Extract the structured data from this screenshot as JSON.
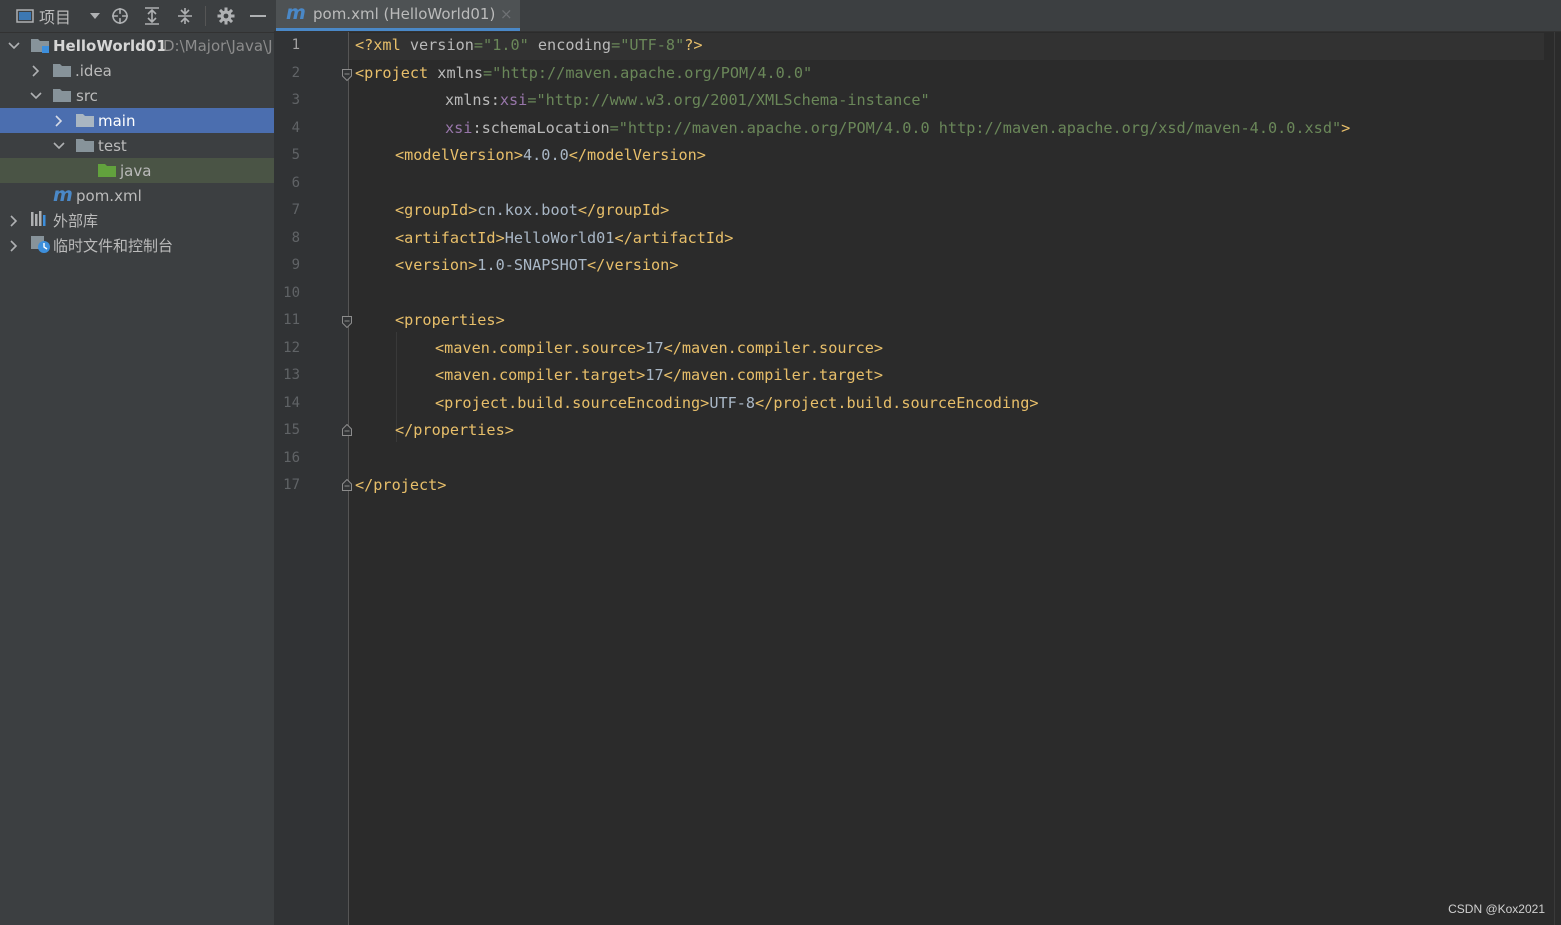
{
  "colors": {
    "sidebar_bg": "#3c3f41",
    "editor_bg": "#2b2b2b",
    "selection": "#4b6eaf",
    "test_highlight": "#4a5445",
    "tag": "#e8bf6a",
    "attribute_value": "#6a8759",
    "namespace": "#9876aa",
    "maven_icon": "#4a88c7"
  },
  "project_panel": {
    "title": "项目",
    "toolbar_icons": [
      "project-view-icon",
      "dropdown-icon",
      "locate-icon",
      "expand-all-icon",
      "collapse-all-icon",
      "gear-icon",
      "minimize-icon"
    ],
    "tree": [
      {
        "label": "HelloWorld01",
        "path": "D:\\Major\\Java\\J",
        "icon": "module-folder-icon",
        "expanded": true
      },
      {
        "label": ".idea",
        "icon": "folder-icon",
        "expanded": false
      },
      {
        "label": "src",
        "icon": "folder-icon",
        "expanded": true
      },
      {
        "label": "main",
        "icon": "folder-icon",
        "expanded": false,
        "selected": true
      },
      {
        "label": "test",
        "icon": "folder-icon",
        "expanded": true
      },
      {
        "label": "java",
        "icon": "test-source-folder-icon"
      },
      {
        "label": "pom.xml",
        "icon": "maven-icon"
      },
      {
        "label": "外部库",
        "icon": "library-icon",
        "expanded": false
      },
      {
        "label": "临时文件和控制台",
        "icon": "scratches-icon",
        "expanded": false
      }
    ]
  },
  "editor": {
    "tab": {
      "label": "pom.xml (HelloWorld01)",
      "icon": "maven-icon",
      "close": "×"
    },
    "current_line": 1,
    "lines": [
      {
        "n": "1"
      },
      {
        "n": "2"
      },
      {
        "n": "3"
      },
      {
        "n": "4"
      },
      {
        "n": "5"
      },
      {
        "n": "6"
      },
      {
        "n": "7"
      },
      {
        "n": "8"
      },
      {
        "n": "9"
      },
      {
        "n": "10"
      },
      {
        "n": "11"
      },
      {
        "n": "12"
      },
      {
        "n": "13"
      },
      {
        "n": "14"
      },
      {
        "n": "15"
      },
      {
        "n": "16"
      },
      {
        "n": "17"
      }
    ],
    "code": {
      "l1": {
        "open": "<?xml ",
        "a1": "version",
        "eq1": "=",
        "v1": "\"1.0\"",
        "a2": " encoding",
        "eq2": "=",
        "v2": "\"UTF-8\"",
        "close": "?>"
      },
      "l2": {
        "open": "<project ",
        "a1": "xmlns",
        "eq": "=",
        "v1": "\"http://maven.apache.org/POM/4.0.0\""
      },
      "l3": {
        "a1": "xmlns",
        "colon": ":",
        "ns": "xsi",
        "eq": "=",
        "v1": "\"http://www.w3.org/2001/XMLSchema-instance\""
      },
      "l4": {
        "ns": "xsi",
        "colon": ":",
        "a1": "schemaLocation",
        "eq": "=",
        "v1": "\"http://maven.apache.org/POM/4.0.0 http://maven.apache.org/xsd/maven-4.0.0.xsd\"",
        "close": ">"
      },
      "l5": {
        "open": "<modelVersion>",
        "text": "4.0.0",
        "close": "</modelVersion>"
      },
      "l7": {
        "open": "<groupId>",
        "text": "cn.kox.boot",
        "close": "</groupId>"
      },
      "l8": {
        "open": "<artifactId>",
        "text": "HelloWorld01",
        "close": "</artifactId>"
      },
      "l9": {
        "open": "<version>",
        "text": "1.0-SNAPSHOT",
        "close": "</version>"
      },
      "l11": {
        "open": "<properties>"
      },
      "l12": {
        "open": "<maven.compiler.source>",
        "text": "17",
        "close": "</maven.compiler.source>"
      },
      "l13": {
        "open": "<maven.compiler.target>",
        "text": "17",
        "close": "</maven.compiler.target>"
      },
      "l14": {
        "open": "<project.build.sourceEncoding>",
        "text": "UTF-8",
        "close": "</project.build.sourceEncoding>"
      },
      "l15": {
        "close": "</properties>"
      },
      "l17": {
        "close": "</project>"
      }
    }
  },
  "watermark": "CSDN @Kox2021"
}
